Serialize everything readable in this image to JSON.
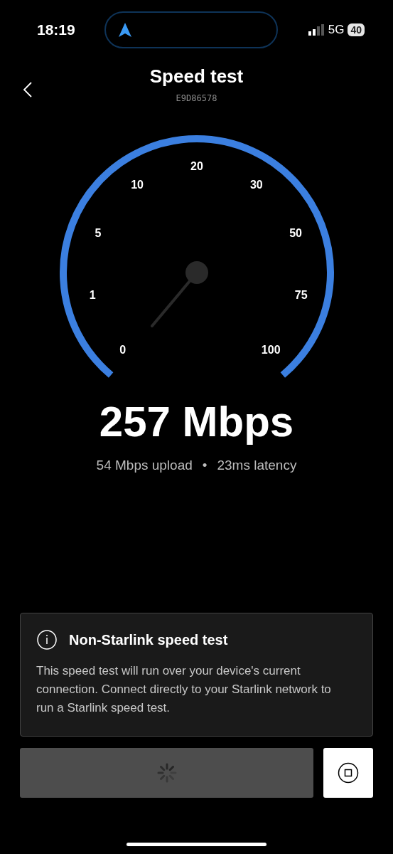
{
  "status_bar": {
    "time": "18:19",
    "network": "5G",
    "battery": "40"
  },
  "header": {
    "title": "Speed test",
    "subtitle": "E9D86578"
  },
  "gauge": {
    "tick_labels": [
      "0",
      "1",
      "5",
      "10",
      "20",
      "30",
      "50",
      "75",
      "100"
    ]
  },
  "result": {
    "speed": "257 Mbps",
    "upload": "54 Mbps upload",
    "separator": "•",
    "latency": "23ms latency"
  },
  "info_card": {
    "title": "Non-Starlink speed test",
    "body": "This speed test will run over your device's current connection. Connect directly to your Starlink network to run a Starlink speed test."
  },
  "run_button": {
    "loading": true
  }
}
